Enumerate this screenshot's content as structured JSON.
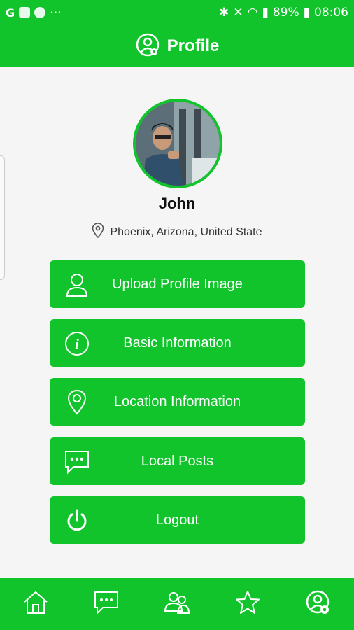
{
  "status_bar": {
    "left_glyphs": [
      "G",
      "⋯"
    ],
    "battery": "89%",
    "time": "08:06"
  },
  "app_bar": {
    "title": "Profile",
    "icon": "profile-settings-icon"
  },
  "profile": {
    "name": "John",
    "location": "Phoenix, Arizona, United State"
  },
  "menu": [
    {
      "label": "Upload Profile Image",
      "icon": "user-icon"
    },
    {
      "label": "Basic Information",
      "icon": "info-icon"
    },
    {
      "label": "Location Information",
      "icon": "location-pin-icon"
    },
    {
      "label": "Local Posts",
      "icon": "chat-bubble-icon"
    },
    {
      "label": "Logout",
      "icon": "power-icon"
    }
  ],
  "bottom_nav": [
    {
      "name": "home",
      "icon": "home-icon"
    },
    {
      "name": "messages",
      "icon": "chat-icon"
    },
    {
      "name": "friends",
      "icon": "people-icon"
    },
    {
      "name": "favorites",
      "icon": "star-icon"
    },
    {
      "name": "profile",
      "icon": "profile-settings-icon"
    }
  ],
  "colors": {
    "brand_green": "#11c42b",
    "background": "#f5f5f5"
  }
}
